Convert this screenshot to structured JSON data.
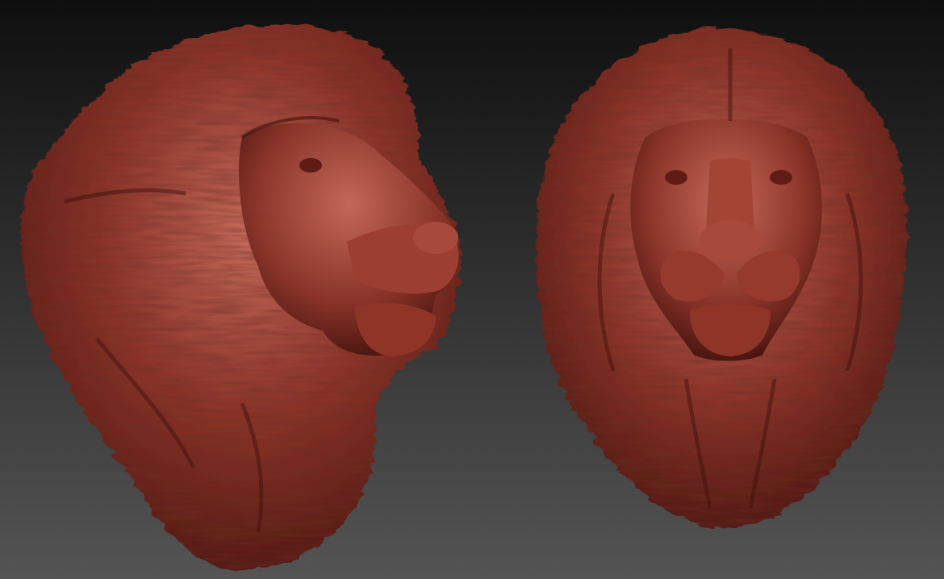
{
  "scene": {
    "background_top": "#0f0f0f",
    "background_bottom": "#545454",
    "clay_color": "#8a3328",
    "clay_highlight": "#c46a5a",
    "clay_shadow": "#3d100b",
    "models": [
      {
        "view": "three-quarter"
      },
      {
        "view": "front"
      }
    ]
  }
}
